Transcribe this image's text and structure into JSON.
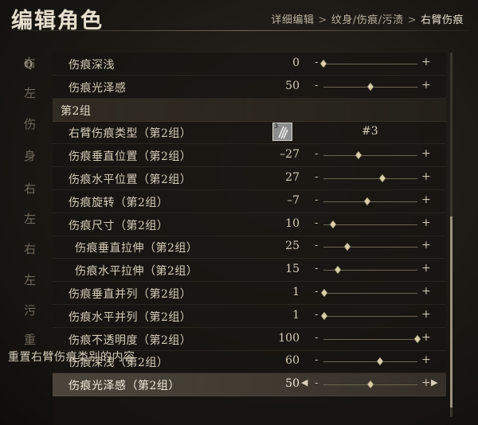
{
  "title": "编辑角色",
  "breadcrumb": [
    "详细编辑",
    "纹身/伤痕/污渍",
    "右臂伤痕"
  ],
  "breadcrumb_sep": ">",
  "left_list": {
    "search_glyph": "Q",
    "items": [
      "右",
      "左",
      "伤",
      "身",
      "右",
      "左",
      "右",
      "左",
      "污",
      "重"
    ]
  },
  "rows": [
    {
      "type": "slider",
      "label": "伤痕深浅",
      "value": "0",
      "level": 0.0
    },
    {
      "type": "slider",
      "label": "伤痕光泽感",
      "value": "50",
      "level": 0.5
    },
    {
      "type": "header",
      "label": "第2组"
    },
    {
      "type": "type",
      "label": "右臂伤痕类型（第2组）",
      "thumb_num": "3",
      "value": "#3"
    },
    {
      "type": "slider",
      "label": "伤痕垂直位置（第2组）",
      "value": "–27",
      "level": 0.37
    },
    {
      "type": "slider",
      "label": "伤痕水平位置（第2组）",
      "value": "27",
      "level": 0.63
    },
    {
      "type": "slider",
      "label": "伤痕旋转（第2组）",
      "value": "–7",
      "level": 0.47
    },
    {
      "type": "slider",
      "label": "伤痕尺寸（第2组）",
      "value": "10",
      "level": 0.1
    },
    {
      "type": "slider",
      "label": "伤痕垂直拉伸（第2组）",
      "value": "25",
      "level": 0.25,
      "indent": true
    },
    {
      "type": "slider",
      "label": "伤痕水平拉伸（第2组）",
      "value": "15",
      "level": 0.15,
      "indent": true
    },
    {
      "type": "slider",
      "label": "伤痕垂直并列（第2组）",
      "value": "1",
      "level": 0.01
    },
    {
      "type": "slider",
      "label": "伤痕水平并列（第2组）",
      "value": "1",
      "level": 0.01
    },
    {
      "type": "slider",
      "label": "伤痕不透明度（第2组）",
      "value": "100",
      "level": 1.0
    },
    {
      "type": "slider",
      "label": "伤痕深浅（第2组）",
      "value": "60",
      "level": 0.6
    },
    {
      "type": "slider",
      "label": "伤痕光泽感（第2组）",
      "value": "50",
      "level": 0.5,
      "selected": true
    }
  ],
  "footer": "重置右臂伤痕类别的内容",
  "glyphs": {
    "minus": "-",
    "plus": "+",
    "arrow_left": "◀",
    "arrow_right": "▶"
  },
  "colors": {
    "accent": "#d8cfa8",
    "background": "#1a1713"
  }
}
